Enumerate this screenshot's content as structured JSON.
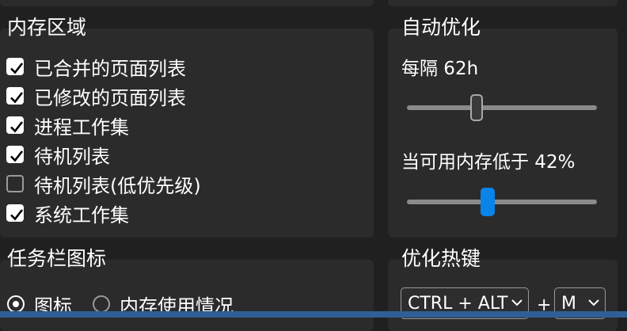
{
  "memory_areas": {
    "title": "内存区域",
    "items": [
      {
        "label": "已合并的页面列表",
        "checked": true
      },
      {
        "label": "已修改的页面列表",
        "checked": true
      },
      {
        "label": "进程工作集",
        "checked": true
      },
      {
        "label": "待机列表",
        "checked": true
      },
      {
        "label": "待机列表(低优先级)",
        "checked": false
      },
      {
        "label": "系统工作集",
        "checked": true
      }
    ]
  },
  "auto_optimize": {
    "title": "自动优化",
    "interval_label": "每隔 62h",
    "interval_fraction": 0.37,
    "threshold_label": "当可用内存低于 42%",
    "threshold_fraction": 0.42
  },
  "taskbar_icon": {
    "title": "任务栏图标",
    "options": [
      {
        "label": "图标",
        "selected": true
      },
      {
        "label": "内存使用情况",
        "selected": false
      }
    ]
  },
  "hotkey": {
    "title": "优化热键",
    "modifier": "CTRL + ALT",
    "plus": "+",
    "key": "M"
  },
  "colors": {
    "accent": "#0a84e8",
    "card": "#2b2b2b",
    "background": "#202020",
    "footer": "#2f5f96"
  }
}
